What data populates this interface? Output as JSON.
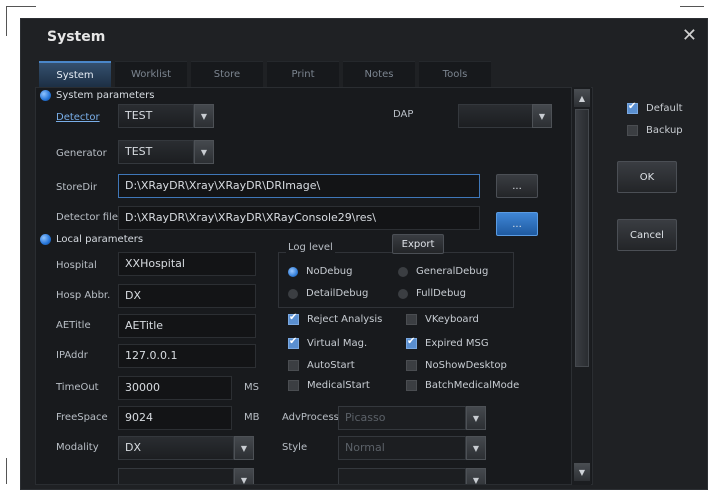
{
  "dialog": {
    "title": "System",
    "close_glyph": "✕"
  },
  "tabs": [
    {
      "label": "System",
      "active": true
    },
    {
      "label": "Worklist",
      "active": false
    },
    {
      "label": "Store",
      "active": false
    },
    {
      "label": "Print",
      "active": false
    },
    {
      "label": "Notes",
      "active": false
    },
    {
      "label": "Tools",
      "active": false
    }
  ],
  "system_params": {
    "header": "System parameters",
    "detector_label": "Detector",
    "detector_value": "TEST",
    "dap_label": "DAP",
    "dap_value": "",
    "generator_label": "Generator",
    "generator_value": "TEST",
    "storedir_label": "StoreDir",
    "storedir_value": "D:\\XRayDR\\Xray\\XRayDR\\DRImage\\",
    "detector_file_label": "Detector file",
    "detector_file_value": "D:\\XRayDR\\Xray\\XRayDR\\XRayConsole29\\res\\",
    "browse_label": "...",
    "browse2_label": "..."
  },
  "local_params": {
    "header": "Local parameters",
    "hospital_label": "Hospital",
    "hospital_value": "XXHospital",
    "hosp_abbr_label": "Hosp Abbr.",
    "hosp_abbr_value": "DX",
    "aetitle_label": "AETitle",
    "aetitle_value": "AETitle",
    "ipaddr_label": "IPAddr",
    "ipaddr_value": "127.0.0.1",
    "timeout_label": "TimeOut",
    "timeout_value": "30000",
    "timeout_unit": "MS",
    "freespace_label": "FreeSpace",
    "freespace_value": "9024",
    "freespace_unit": "MB",
    "modality_label": "Modality",
    "modality_value": "DX"
  },
  "log": {
    "title": "Log level",
    "export_label": "Export",
    "nodebug": "NoDebug",
    "generaldebug": "GeneralDebug",
    "detaildebug": "DetailDebug",
    "fulldebug": "FullDebug",
    "selected": "NoDebug"
  },
  "options": {
    "reject_analysis": {
      "label": "Reject Analysis",
      "checked": true
    },
    "vkeyboard": {
      "label": "VKeyboard",
      "checked": false
    },
    "virtual_mag": {
      "label": "Virtual Mag.",
      "checked": true
    },
    "expired_msg": {
      "label": "Expired MSG",
      "checked": true
    },
    "autostart": {
      "label": "AutoStart",
      "checked": false
    },
    "noshowdesktop": {
      "label": "NoShowDesktop",
      "checked": false
    },
    "medicalstart": {
      "label": "MedicalStart",
      "checked": false
    },
    "batchmedicalmode": {
      "label": "BatchMedicalMode",
      "checked": false
    }
  },
  "advprocess": {
    "label": "AdvProcess",
    "value": "Picasso",
    "style_label": "Style",
    "style_value": "Normal"
  },
  "side": {
    "default": {
      "label": "Default",
      "checked": true
    },
    "backup": {
      "label": "Backup",
      "checked": false
    },
    "ok_label": "OK",
    "cancel_label": "Cancel"
  },
  "colors": {
    "accent": "#2f79d2",
    "background": "#1f2124",
    "panel": "#181a1d"
  }
}
